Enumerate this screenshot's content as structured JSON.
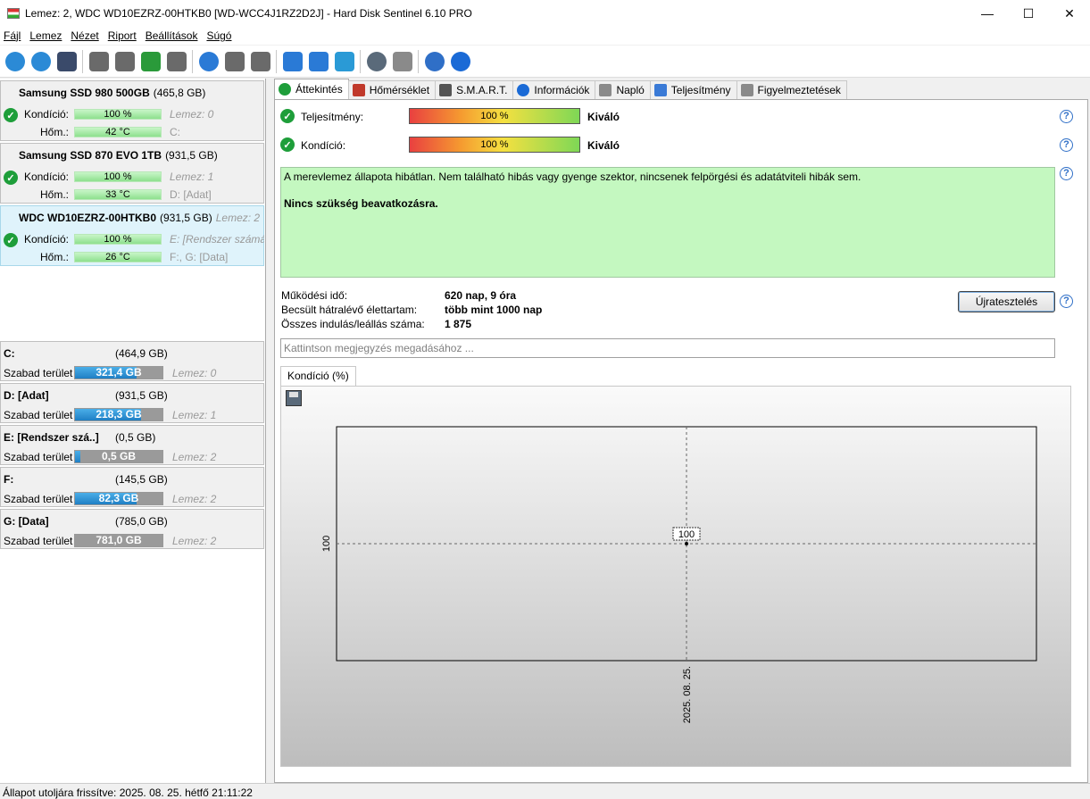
{
  "window": {
    "title": "Lemez: 2, WDC WD10EZRZ-00HTKB0 [WD-WCC4J1RZ2D2J]  -  Hard Disk Sentinel 6.10 PRO",
    "minimize": "—",
    "maximize": "☐",
    "close": "✕"
  },
  "menu": [
    "Fájl",
    "Lemez",
    "Nézet",
    "Riport",
    "Beállítások",
    "Súgó"
  ],
  "toolbar_icons": [
    {
      "name": "refresh-icon",
      "color": "#2b8ad6"
    },
    {
      "name": "refresh-warning-icon",
      "color": "#2b8ad6"
    },
    {
      "name": "disk-list-icon",
      "color": "#3a4a6a"
    },
    {
      "name": "disk-icon",
      "color": "#6a6a6a"
    },
    {
      "name": "disk-clock-icon",
      "color": "#6a6a6a"
    },
    {
      "name": "disk-check-icon",
      "color": "#2a9a3a"
    },
    {
      "name": "disk-search-icon",
      "color": "#6a6a6a"
    },
    {
      "name": "globe-drive-icon",
      "color": "#2a7ad6"
    },
    {
      "name": "network-drive-icon",
      "color": "#6a6a6a"
    },
    {
      "name": "usb-drive-icon",
      "color": "#6a6a6a"
    },
    {
      "name": "report-icon",
      "color": "#2a7ad6"
    },
    {
      "name": "mail-icon",
      "color": "#2a7ad6"
    },
    {
      "name": "web-report-icon",
      "color": "#2a9ad6"
    },
    {
      "name": "settings-gear-icon",
      "color": "#5a6a7a"
    },
    {
      "name": "sound-icon",
      "color": "#8a8a8a"
    },
    {
      "name": "help-icon",
      "color": "#2f6fc7"
    },
    {
      "name": "info-icon",
      "color": "#1a6ad6"
    }
  ],
  "disks": [
    {
      "name": "Samsung SSD 980 500GB",
      "size": "(465,8 GB)",
      "lemez": "",
      "kondicio_label": "Kondíció:",
      "kondicio": "100 %",
      "kondicio_info": "Lemez: 0",
      "hom_label": "Hőm.:",
      "hom": "42 °C",
      "hom_info": "C:",
      "selected": false
    },
    {
      "name": "Samsung SSD 870 EVO 1TB",
      "size": "(931,5 GB)",
      "lemez": "",
      "kondicio_label": "Kondíció:",
      "kondicio": "100 %",
      "kondicio_info": "Lemez: 1",
      "hom_label": "Hőm.:",
      "hom": "33 °C",
      "hom_info": "D: [Adat]",
      "selected": false
    },
    {
      "name": "WDC WD10EZRZ-00HTKB0",
      "size": "(931,5 GB)",
      "lemez": "Lemez: 2",
      "kondicio_label": "Kondíció:",
      "kondicio": "100 %",
      "kondicio_info": "E: [Rendszer számára",
      "hom_label": "Hőm.:",
      "hom": "26 °C",
      "hom_info": "F:, G: [Data]",
      "selected": true
    }
  ],
  "volumes": [
    {
      "name": "C:",
      "size": "(464,9 GB)",
      "free_label": "Szabad terület",
      "free": "321,4 GB",
      "fill": 0.7,
      "lemez": "Lemez: 0"
    },
    {
      "name": "D: [Adat]",
      "size": "(931,5 GB)",
      "free_label": "Szabad terület",
      "free": "218,3 GB",
      "fill": 0.76,
      "lemez": "Lemez: 1"
    },
    {
      "name": "E: [Rendszer szá..]",
      "size": "(0,5 GB)",
      "free_label": "Szabad terület",
      "free": "0,5 GB",
      "fill": 0.06,
      "lemez": "Lemez: 2"
    },
    {
      "name": "F:",
      "size": "(145,5 GB)",
      "free_label": "Szabad terület",
      "free": "82,3 GB",
      "fill": 0.7,
      "lemez": "Lemez: 2"
    },
    {
      "name": "G: [Data]",
      "size": "(785,0 GB)",
      "free_label": "Szabad terület",
      "free": "781,0 GB",
      "fill": 0.0,
      "lemez": "Lemez: 2"
    }
  ],
  "tabs": [
    {
      "label": "Áttekintés",
      "icon": "check-icon",
      "color": "#1e9e3a"
    },
    {
      "label": "Hőmérséklet",
      "icon": "thermometer-icon",
      "color": "#c0392b"
    },
    {
      "label": "S.M.A.R.T.",
      "icon": "disk-icon",
      "color": "#555555"
    },
    {
      "label": "Információk",
      "icon": "info-icon",
      "color": "#1a6ad6"
    },
    {
      "label": "Napló",
      "icon": "document-icon",
      "color": "#8a8a8a"
    },
    {
      "label": "Teljesítmény",
      "icon": "chart-icon",
      "color": "#3a7ad6"
    },
    {
      "label": "Figyelmeztetések",
      "icon": "warning-doc-icon",
      "color": "#8a8a8a"
    }
  ],
  "overview": {
    "performance_label": "Teljesítmény:",
    "performance_value": "100 %",
    "performance_rating": "Kiváló",
    "condition_label": "Kondíció:",
    "condition_value": "100 %",
    "condition_rating": "Kiváló",
    "status_text": "A merevlemez állapota hibátlan. Nem található hibás vagy gyenge szektor, nincsenek felpörgési és adatátviteli hibák sem.",
    "action_text": "Nincs szükség beavatkozásra.",
    "uptime_label": "Működési idő:",
    "uptime_value": "620 nap, 9 óra",
    "lifetime_label": "Becsült hátralévő élettartam:",
    "lifetime_value": "több mint 1000 nap",
    "starts_label": "Összes indulás/leállás száma:",
    "starts_value": "1 875",
    "retest_button": "Újratesztelés",
    "note_placeholder": "Kattintson megjegyzés megadásához ...",
    "chart_tab": "Kondíció  (%)",
    "help": "?"
  },
  "chart_data": {
    "type": "line",
    "title": "",
    "xlabel": "",
    "ylabel": "",
    "x": [
      "2025. 08. 25."
    ],
    "series": [
      {
        "values": [
          100
        ]
      }
    ],
    "y_tick_labels": [
      "100"
    ],
    "data_labels": [
      "100"
    ]
  },
  "status_bar": "Állapot utoljára frissítve: 2025. 08. 25. hétfő 21:11:22"
}
